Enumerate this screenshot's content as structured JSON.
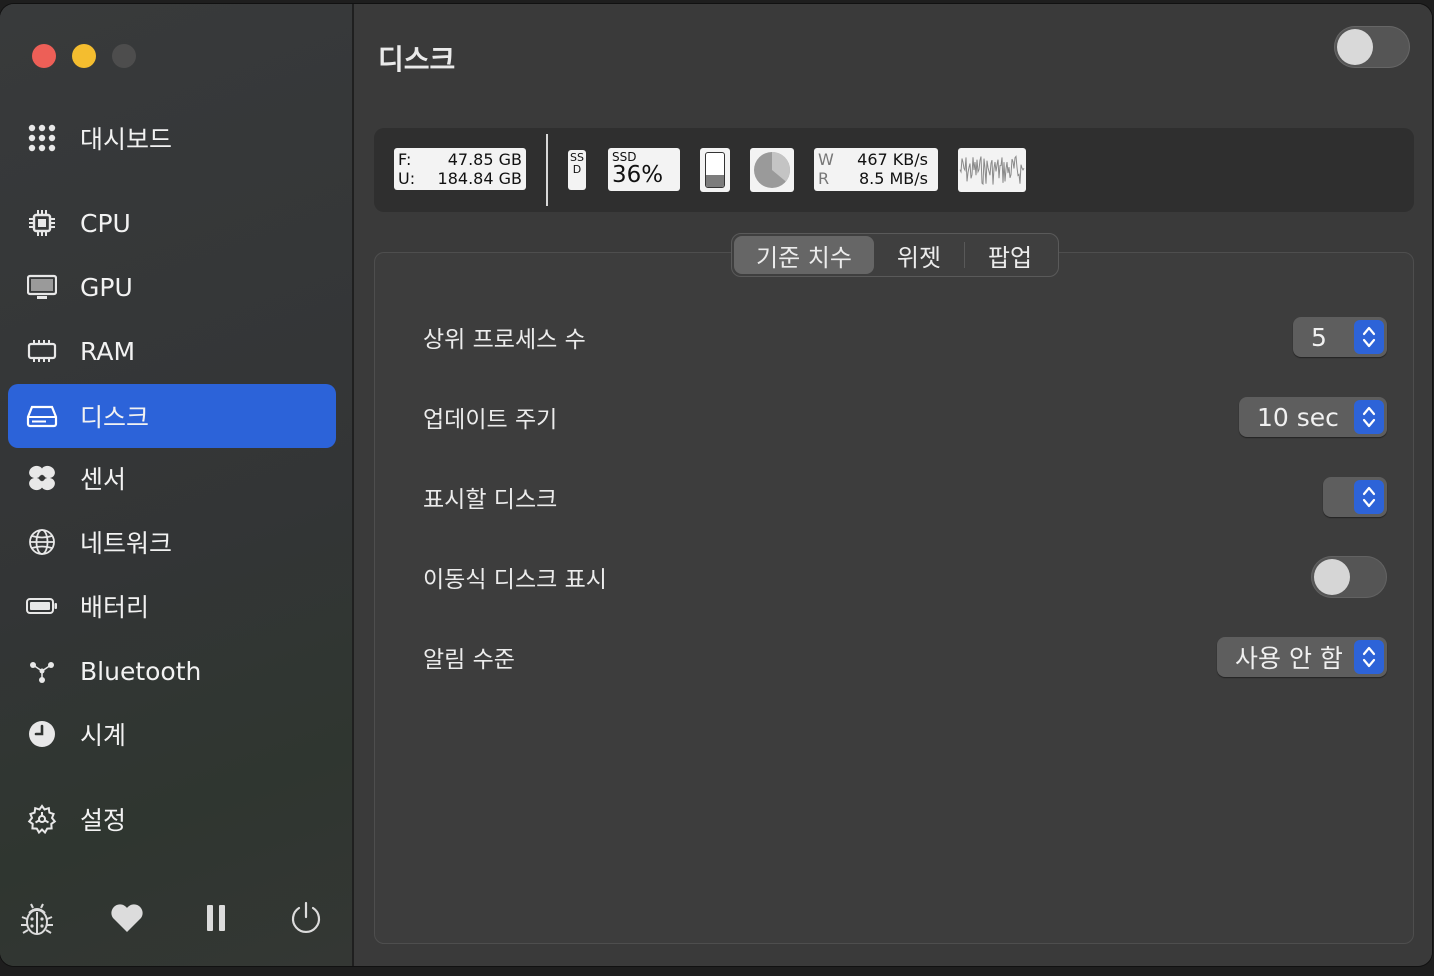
{
  "sidebar": {
    "items": [
      {
        "label": "대시보드",
        "icon": "grid-icon"
      },
      {
        "label": "CPU",
        "icon": "cpu-icon"
      },
      {
        "label": "GPU",
        "icon": "monitor-icon"
      },
      {
        "label": "RAM",
        "icon": "memory-icon"
      },
      {
        "label": "디스크",
        "icon": "disk-icon",
        "active": true
      },
      {
        "label": "센서",
        "icon": "fan-icon"
      },
      {
        "label": "네트워크",
        "icon": "globe-icon"
      },
      {
        "label": "배터리",
        "icon": "battery-icon"
      },
      {
        "label": "Bluetooth",
        "icon": "bluetooth-icon"
      },
      {
        "label": "시계",
        "icon": "clock-icon"
      },
      {
        "label": "설정",
        "icon": "gear-icon"
      }
    ],
    "bottom_icons": [
      "bug-icon",
      "heart-icon",
      "pause-icon",
      "power-icon"
    ]
  },
  "main": {
    "title": "디스크",
    "enabled": false
  },
  "widgets": {
    "free_label": "F:",
    "free_value": "47.85 GB",
    "used_label": "U:",
    "used_value": "184.84 GB",
    "ssd_vertical": "SSD",
    "ssd_small": "SSD",
    "ssd_percent": "36%",
    "write_label": "W",
    "write_value": "467 KB/s",
    "read_label": "R",
    "read_value": "8.5 MB/s",
    "bar_fill_fraction": 0.36,
    "pie_fraction": 0.36
  },
  "tabs": [
    "기준 치수",
    "위젯",
    "팝업"
  ],
  "active_tab": 0,
  "settings": {
    "top_processes": {
      "label": "상위 프로세스 수",
      "value": "5"
    },
    "update_interval": {
      "label": "업데이트 주기",
      "value": "10 sec"
    },
    "disk_to_show": {
      "label": "표시할 디스크",
      "value": ""
    },
    "removable": {
      "label": "이동식 디스크 표시",
      "enabled": false
    },
    "notification": {
      "label": "알림 수준",
      "value": "사용 안 함"
    }
  },
  "colors": {
    "accent": "#2c63d9",
    "traffic_red": "#ed5f57",
    "traffic_yellow": "#f4bd2f"
  }
}
